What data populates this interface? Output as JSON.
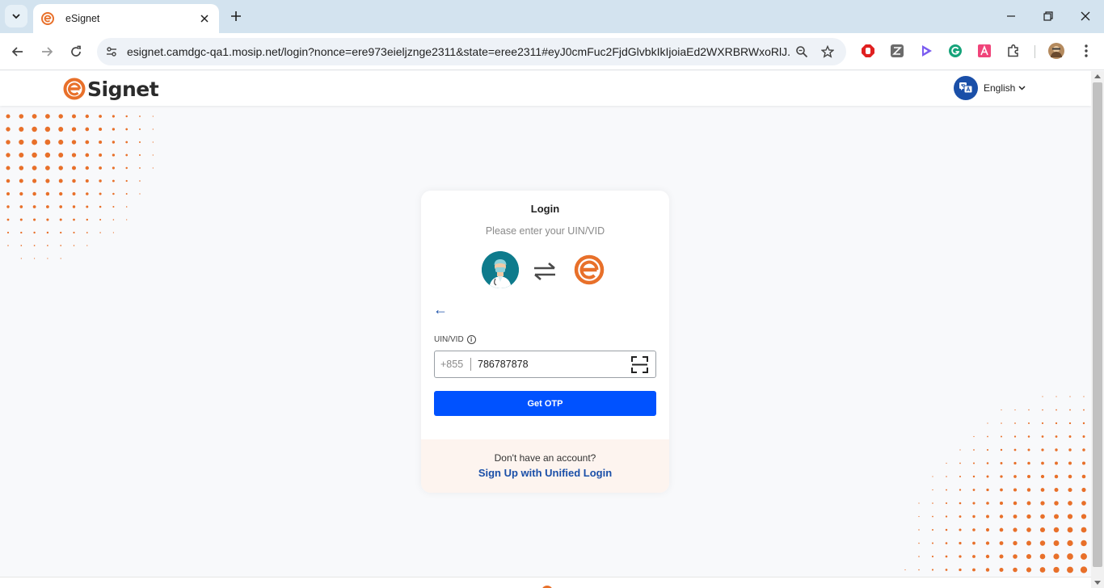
{
  "browser": {
    "tab": {
      "title": "eSignet"
    },
    "url": "esignet.camdgc-qa1.mosip.net/login?nonce=ere973eieljznge2311&state=eree2311#eyJ0cmFuc2FjdGlvbkIkIjoiaEd2WXRBRWxoRlJ..."
  },
  "header": {
    "logo_text": "Signet",
    "language": "English"
  },
  "login": {
    "title": "Login",
    "subtitle": "Please enter your UIN/VID",
    "back_arrow": "←",
    "field_label": "UIN/VID",
    "info_glyph": "i",
    "prefix": "+855",
    "value": "786787878",
    "button": "Get OTP",
    "no_account": "Don't have an account?",
    "signup": "Sign Up with Unified Login"
  },
  "colors": {
    "brand_orange": "#e8702a",
    "primary_blue": "#0052ff",
    "link_blue": "#1a4fa8",
    "footer_bg": "#fdf4ef"
  },
  "icons": {
    "tab_search": "chevron-down-icon",
    "favicon": "esignet-favicon-icon",
    "tab_close": "close-icon",
    "new_tab": "plus-icon",
    "minimize": "minimize-icon",
    "restore": "restore-icon",
    "close_window": "close-icon",
    "back": "arrow-left-icon",
    "forward": "arrow-right-icon",
    "reload": "reload-icon",
    "site_info": "tune-icon",
    "zoom": "zoom-icon",
    "bookmark": "star-icon",
    "extensions": [
      "adblock-icon",
      "zotero-icon",
      "video-icon",
      "grammarly-icon",
      "font-icon",
      "puzzle-icon"
    ],
    "profile": "profile-avatar-icon",
    "menu": "kebab-menu-icon",
    "language": "translate-icon",
    "swap": "swap-arrows-icon",
    "scan": "qr-scan-icon",
    "info": "info-icon"
  }
}
